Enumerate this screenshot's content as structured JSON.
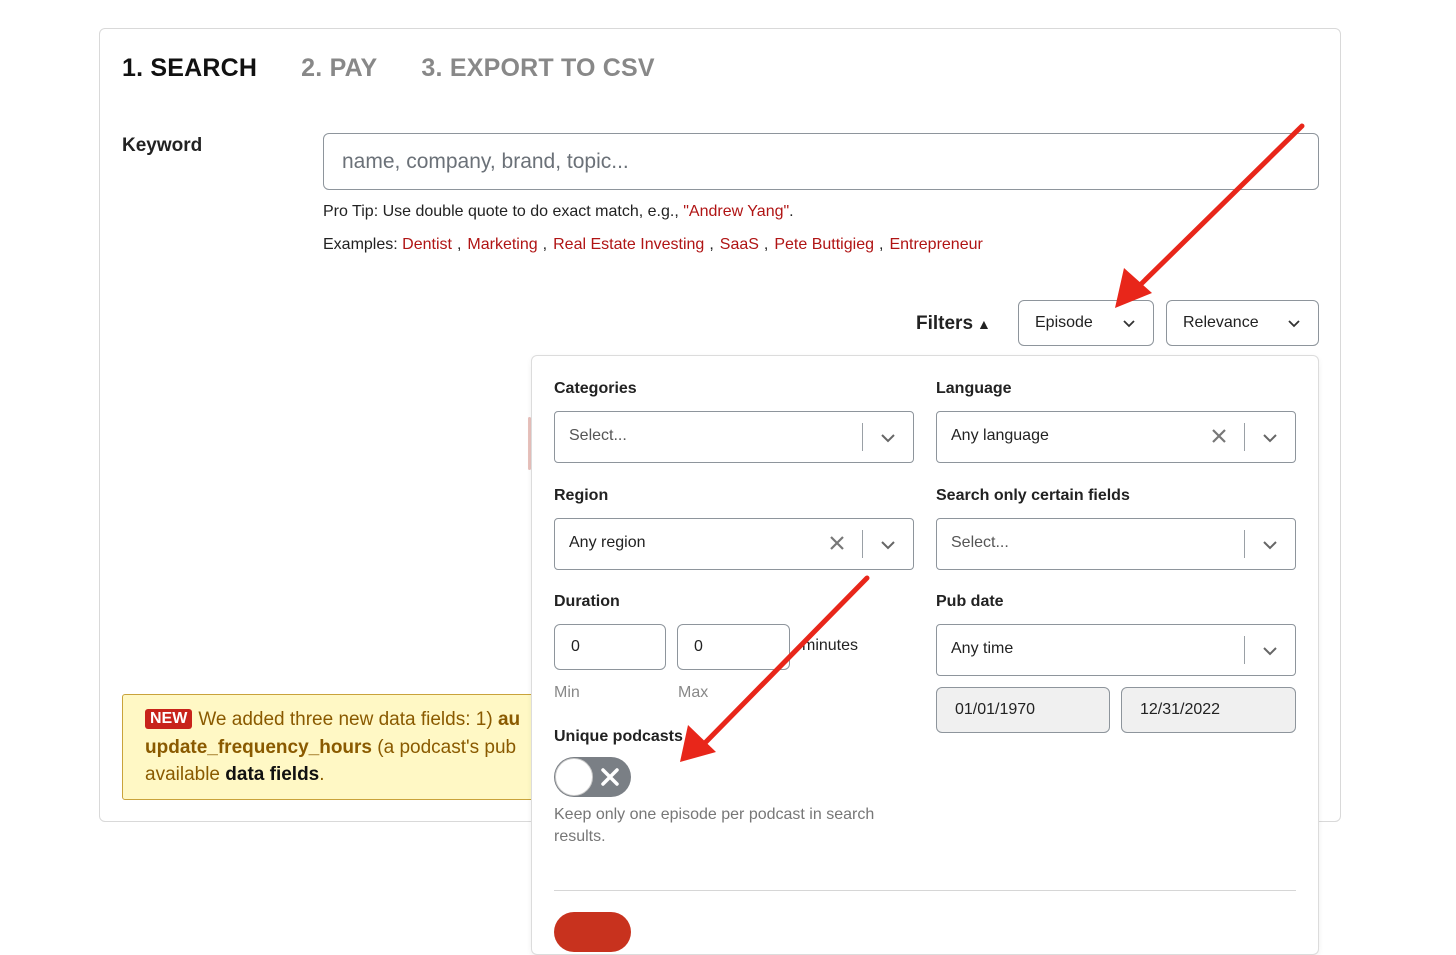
{
  "steps": [
    "1. SEARCH",
    "2. PAY",
    "3. EXPORT TO CSV"
  ],
  "keyword": {
    "label": "Keyword",
    "placeholder": "name, company, brand, topic...",
    "protip_prefix": "Pro Tip: Use double quote to do exact match, e.g., ",
    "protip_example": "\"Andrew Yang\"",
    "protip_suffix": ".",
    "examples_label": "Examples:",
    "examples": [
      "Dentist",
      "Marketing",
      "Real Estate Investing",
      "SaaS",
      "Pete Buttigieg",
      "Entrepreneur"
    ]
  },
  "toolbar": {
    "filters_label": "Filters",
    "filters_arrow": "▲",
    "type_select": "Episode",
    "sort_select": "Relevance"
  },
  "filters": {
    "categories": {
      "label": "Categories",
      "placeholder": "Select..."
    },
    "language": {
      "label": "Language",
      "value": "Any language"
    },
    "region": {
      "label": "Region",
      "value": "Any region"
    },
    "fields": {
      "label": "Search only certain fields",
      "placeholder": "Select..."
    },
    "duration": {
      "label": "Duration",
      "min": "0",
      "max": "0",
      "unit": "minutes",
      "min_label": "Min",
      "max_label": "Max"
    },
    "pub_date": {
      "label": "Pub date",
      "value": "Any time",
      "from": "01/01/1970",
      "to": "12/31/2022"
    },
    "unique": {
      "label": "Unique podcasts",
      "description": "Keep only one episode per podcast in search results.",
      "enabled": false
    }
  },
  "notice": {
    "badge": "NEW",
    "line1": "We added three new data fields: 1) ",
    "line1_bold": "au",
    "line2_bold": "update_frequency_hours",
    "line2": " (a podcast's pub",
    "line3": "available ",
    "line3_bold": "data fields",
    "line3_end": "."
  },
  "colors": {
    "accent": "#b01414",
    "arrow": "#e8261a",
    "notice_bg": "#fff8c5"
  }
}
